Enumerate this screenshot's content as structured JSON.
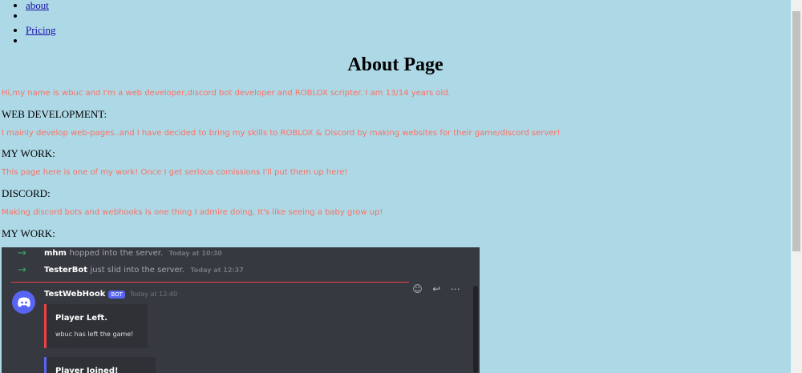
{
  "nav": {
    "items": [
      {
        "label": "about"
      },
      {
        "label": ""
      },
      {
        "label": "Pricing"
      },
      {
        "label": ""
      }
    ]
  },
  "page_title": "About Page",
  "intro": "Hi,my name is wbuc and I'm a web developer,discord bot developer and ROBLOX scripter. I am 13/14 years old.",
  "sections": [
    {
      "heading": "WEB DEVELOPMENT:",
      "text": "I mainly develop web-pages..and I have decided to bring my skills to ROBLOX & Discord by making websites for their game/discord server!"
    },
    {
      "heading": "MY WORK:",
      "text": "This page here is one of my work! Once I get serious comissions I'll put them up here!"
    },
    {
      "heading": "DISCORD:",
      "text": "Making discord bots and webhooks is one thing I admire doing, It's like seeing a baby grow up!"
    },
    {
      "heading": "MY WORK:",
      "text": ""
    }
  ],
  "discord": {
    "system_messages": [
      {
        "name": "mhm",
        "text": "hopped into the server.",
        "time": "Today at 10:30"
      },
      {
        "name": "TesterBot",
        "text": "just slid into the server.",
        "time": "Today at 12:37"
      }
    ],
    "message": {
      "username": "TestWebHook",
      "tag": "BOT",
      "time": "Today at 12:40"
    },
    "embeds": [
      {
        "title": "Player Left.",
        "description": "wbuc has left the game!",
        "color": "#ed4245"
      },
      {
        "title": "Player Joined!",
        "description": "",
        "color": "#5865f2"
      }
    ],
    "colors": {
      "background": "#36393f",
      "blurple": "#5865f2",
      "join_arrow": "#3ba55d"
    }
  }
}
